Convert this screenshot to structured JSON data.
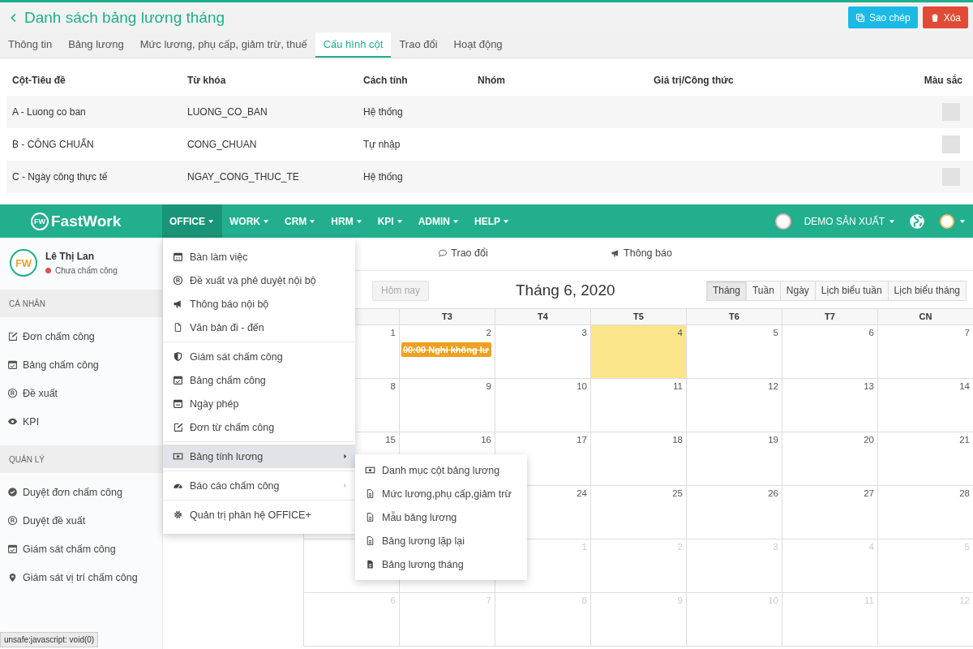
{
  "page": {
    "title": "Danh sách bảng lương tháng",
    "actions": [
      {
        "label": "Sao chép",
        "kind": "copy"
      },
      {
        "label": "Xóa",
        "kind": "delete"
      }
    ],
    "tabs": [
      {
        "label": "Thông tin",
        "selected": false
      },
      {
        "label": "Bảng lương",
        "selected": false
      },
      {
        "label": "Mức lương, phụ cấp, giảm trừ, thuế",
        "selected": false
      },
      {
        "label": "Cấu hình cột",
        "selected": true
      },
      {
        "label": "Trao đổi",
        "selected": false
      },
      {
        "label": "Hoạt động",
        "selected": false
      }
    ],
    "table": {
      "columns": [
        "Cột-Tiêu đề",
        "Từ khóa",
        "Cách tính",
        "Nhóm",
        "Giá trị/Công thức",
        "Màu sắc"
      ],
      "rows": [
        [
          "A - Luong co ban",
          "LUONG_CO_BAN",
          "Hệ thống"
        ],
        [
          "B - CÔNG CHUẨN",
          "CONG_CHUAN",
          "Tự nhập"
        ],
        [
          "C - Ngày công thực tế",
          "NGAY_CONG_THUC_TE",
          "Hệ thống"
        ]
      ]
    }
  },
  "app": {
    "logo_mark": "FW",
    "brand": "FastWork",
    "menu": [
      {
        "label": "OFFICE",
        "selected": true
      },
      {
        "label": "WORK",
        "selected": false
      },
      {
        "label": "CRM",
        "selected": false
      },
      {
        "label": "HRM",
        "selected": false
      },
      {
        "label": "KPI",
        "selected": false
      },
      {
        "label": "ADMIN",
        "selected": false
      },
      {
        "label": "HELP",
        "selected": false
      }
    ],
    "company": "DEMO SẢN XUẤT",
    "user": {
      "avatar": "FW",
      "name": "Lê Thị Lan",
      "status": {
        "text": "Chưa chấm công",
        "color": "#d9534f"
      }
    },
    "sidebar": [
      {
        "title": "CÁ NHÂN",
        "items": [
          "Đơn chấm công",
          "Bảng chấm công",
          "Đề xuất",
          "KPI"
        ]
      },
      {
        "title": "QUẢN LÝ",
        "items": [
          "Duyệt đơn chấm công",
          "Duyệt đề xuất",
          "Giám sát chấm công",
          "Giám sát vị trí chấm công"
        ]
      }
    ],
    "calendar": {
      "tabs": [
        {
          "label": "Trao đổi",
          "selected": false
        },
        {
          "label": "Thông báo",
          "selected": false
        }
      ],
      "today_button": "Hôm nay",
      "title": "Tháng 6, 2020",
      "views": [
        {
          "label": "Tháng",
          "selected": true
        },
        {
          "label": "Tuần",
          "selected": false
        },
        {
          "label": "Ngày",
          "selected": false
        },
        {
          "label": "Lịch biểu tuần",
          "selected": false
        },
        {
          "label": "Lịch biểu tháng",
          "selected": false
        }
      ],
      "weekdays": [
        "T3",
        "T4",
        "T5",
        "T6",
        "T7",
        "CN"
      ],
      "weeks": [
        [
          {
            "day": "1"
          },
          {
            "day": "2",
            "event": {
              "text": "00:00 Nghỉ không lư",
              "struck": true
            }
          },
          {
            "day": "3"
          },
          {
            "day": "4",
            "today": true
          },
          {
            "day": "5"
          },
          {
            "day": "6"
          },
          {
            "day": "7"
          }
        ],
        [
          {
            "day": "8"
          },
          {
            "day": "9"
          },
          {
            "day": "10"
          },
          {
            "day": "11"
          },
          {
            "day": "12"
          },
          {
            "day": "13"
          },
          {
            "day": "14"
          }
        ],
        [
          {
            "day": "15"
          },
          {
            "day": "16"
          },
          {
            "day": "17"
          },
          {
            "day": "18"
          },
          {
            "day": "19"
          },
          {
            "day": "20"
          },
          {
            "day": "21"
          }
        ],
        [
          {
            "day": "24"
          },
          {
            "day": "25"
          },
          {
            "day": "26"
          },
          {
            "day": "27"
          },
          {
            "day": "28"
          }
        ],
        [
          {
            "day": "1",
            "other_month": true
          },
          {
            "day": "2",
            "other_month": true
          },
          {
            "day": "3",
            "other_month": true
          },
          {
            "day": "4",
            "other_month": true
          },
          {
            "day": "5",
            "other_month": true
          }
        ],
        [
          {
            "day": "6",
            "other_month": true
          },
          {
            "day": "7",
            "other_month": true
          },
          {
            "day": "8",
            "other_month": true
          },
          {
            "day": "9",
            "other_month": true
          },
          {
            "day": "10",
            "other_month": true
          },
          {
            "day": "11",
            "other_month": true
          },
          {
            "day": "12",
            "other_month": true
          }
        ]
      ]
    },
    "office_menu": [
      [
        {
          "label": "Bàn làm việc",
          "selected": false
        },
        {
          "label": "Đề xuất và phê duyệt nội bộ",
          "selected": false
        },
        {
          "label": "Thông báo nội bộ",
          "selected": false
        },
        {
          "label": "Văn bản đi - đến",
          "selected": false
        }
      ],
      [
        {
          "label": "Giám sát chấm công",
          "selected": false
        },
        {
          "label": "Bảng chấm công",
          "selected": false
        },
        {
          "label": "Ngày phép",
          "selected": false
        },
        {
          "label": "Đơn từ chấm công",
          "selected": false
        }
      ],
      [
        {
          "label": "Bảng tính lương",
          "selected": true,
          "has_submenu": true
        }
      ],
      [
        {
          "label": "Báo cáo chấm công",
          "selected": false,
          "has_submenu": true
        }
      ],
      [
        {
          "label": "Quản trị phân hệ OFFICE+",
          "selected": false
        }
      ]
    ],
    "submenu": [
      "Danh mục cột bảng lương",
      "Mức lương,phụ cấp,giảm trừ",
      "Mẫu bảng lương",
      "Bảng lương lặp lại",
      "Bảng lương tháng"
    ],
    "status_text": "unsafe:javascript: void(0)"
  }
}
